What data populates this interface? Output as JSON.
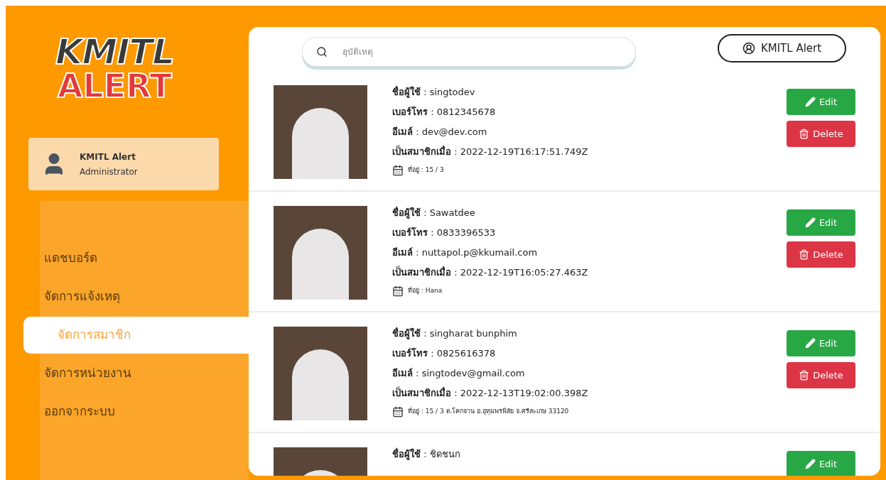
{
  "logo": {
    "line_1": "KMITL",
    "line_2": "ALERT"
  },
  "user_card": {
    "name": "KMITL Alert",
    "role": "Administrator"
  },
  "menu": [
    {
      "label": "แดชบอร์ด",
      "selected": false
    },
    {
      "label": "จัดการแจ้งเหตุ",
      "selected": false
    },
    {
      "label": "จัดการสมาชิก",
      "selected": true
    },
    {
      "label": "จัดการหน่วยงาน",
      "selected": false
    },
    {
      "label": "ออกจากระบบ",
      "selected": false
    }
  ],
  "search": {
    "placeholder": "อุบัติเหตุ"
  },
  "account_button": "KMITL Alert",
  "members": [
    {
      "lines": [
        "**ชื่อผู้ใช้** : singtodev",
        "**เบอร์โทร** : 0812345678",
        "**อีเมล์** : dev@dev.com",
        "**เป็นสมาชิกเมื่อ** : 2022-12-19T16:17:51.749Z"
      ],
      "address": "ที่อยู่ : 15 / 3",
      "edit": "Edit",
      "delete": "Delete"
    },
    {
      "lines": [
        "**ชื่อผู้ใช้** : Sawatdee",
        "**เบอร์โทร** : 0833396533",
        "**อีเมล์** : nuttapol.p@kkumail.com",
        "**เป็นสมาชิกเมื่อ** : 2022-12-19T16:05:27.463Z"
      ],
      "address": "ที่อยู่ : Hana",
      "edit": "Edit",
      "delete": "Delete"
    },
    {
      "lines": [
        "**ชื่อผู้ใช้** : singharat bunphim",
        "**เบอร์โทร** : 0825616378",
        "**อีเมล์** : singtodev@gmail.com",
        "**เป็นสมาชิกเมื่อ** : 2022-12-13T19:02:00.398Z"
      ],
      "address": "ที่อยู่ : 15 / 3 ต.โคกจาน อ.อุทุมพรพิสัย จ.ศรีสะเกษ 33120",
      "edit": "Edit",
      "delete": "Delete"
    },
    {
      "lines": [
        "**ชื่อผู้ใช้** : ชิดชนก"
      ],
      "edit": "Edit"
    }
  ]
}
